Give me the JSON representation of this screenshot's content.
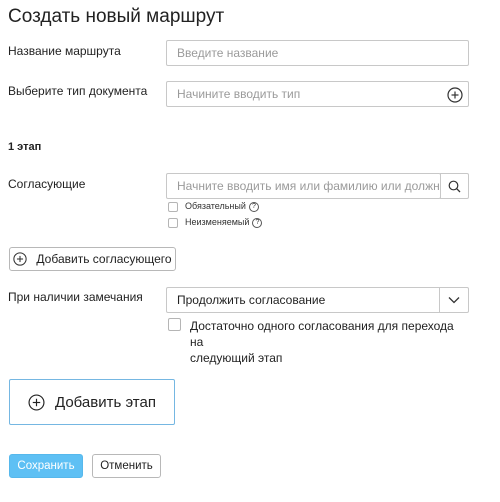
{
  "page": {
    "title": "Создать новый маршрут"
  },
  "route_name": {
    "label": "Название маршрута",
    "placeholder": "Введите название",
    "value": ""
  },
  "doc_type": {
    "label": "Выберите тип документа",
    "placeholder": "Начините вводить тип",
    "add_icon": "plus-circle-icon"
  },
  "stage": {
    "title": "1 этап",
    "approvers_label": "Согласующие",
    "approvers_placeholder": "Начните вводить имя или фамилию или должност",
    "search_icon": "search-icon",
    "mandatory_label": "Обязательный",
    "immutable_label": "Неизменяемый",
    "help_icon": "question-circle-icon",
    "add_approver_label": "Добавить согласующего",
    "remark_label": "При наличии замечания",
    "remark_selected": "Продолжить согласование",
    "single_approval_label_line1": "Достаточно одного согласования для перехода на",
    "single_approval_label_line2": "следующий этап"
  },
  "add_stage_label": "Добавить этап",
  "footer": {
    "save_label": "Сохранить",
    "cancel_label": "Отменить"
  },
  "colors": {
    "accent": "#5ec0f4",
    "accent_border": "#75b7e2",
    "border": "#c8c8c8",
    "placeholder": "#9a9a9a"
  }
}
